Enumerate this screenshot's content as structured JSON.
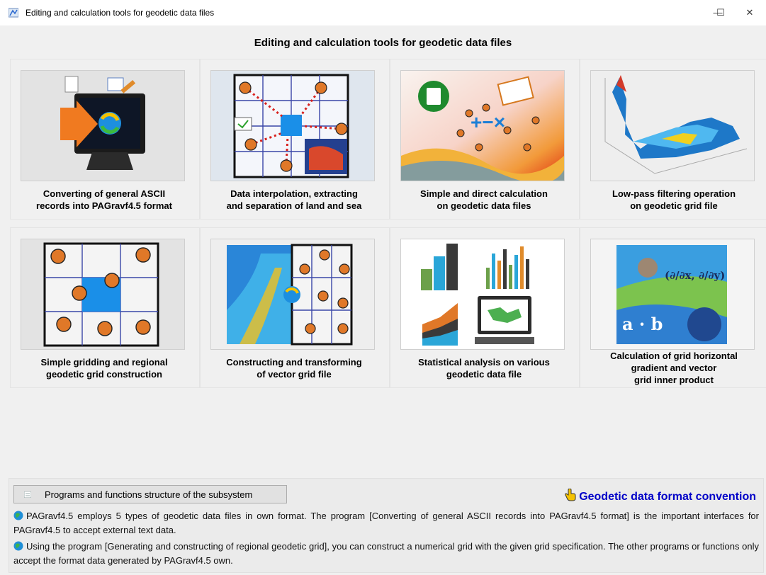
{
  "window": {
    "title": "Editing and calculation tools for geodetic data files",
    "minimize_label": "—",
    "maximize_label": "☐",
    "close_label": "✕",
    "app_icon": "app-icon"
  },
  "heading": "Editing and calculation tools for geodetic data files",
  "tools": [
    {
      "label": "Converting of general ASCII\nrecords into PAGravf4.5 format",
      "icon": "ascii-convert-image"
    },
    {
      "label": "Data interpolation, extracting\nand separation of land and sea",
      "icon": "interpolation-image"
    },
    {
      "label": "Simple and direct calculation\non geodetic data files",
      "icon": "calculation-image"
    },
    {
      "label": "Low-pass filtering operation\non geodetic grid file",
      "icon": "lowpass-filter-image"
    },
    {
      "label": "Simple gridding and regional\ngeodetic grid construction",
      "icon": "gridding-image"
    },
    {
      "label": "Constructing and transforming\nof vector grid file",
      "icon": "vector-grid-image"
    },
    {
      "label": "Statistical analysis on various\ngeodetic data file",
      "icon": "statistics-image"
    },
    {
      "label": "Calculation of grid horizontal\ngradient and vector\ngrid inner product",
      "icon": "gradient-product-image"
    }
  ],
  "bottom": {
    "programs_button": "Programs and functions structure of the subsystem",
    "format_link": "Geodetic data format convention",
    "para1": "PAGravf4.5 employs 5 types of geodetic data files in own format. The program [Converting of general ASCII records into PAGravf4.5 format] is the important interfaces for PAGravf4.5 to accept external text data.",
    "para2": "Using the program [Generating and constructing of regional geodetic grid], you can construct a numerical grid with the given grid specification. The other programs or functions only accept the format data generated by PAGravf4.5 own."
  },
  "image_text": {
    "gradient_formula": "(∂/∂x, ∂/∂y)",
    "dot_product": "a · b"
  },
  "colors": {
    "link": "#0000c8",
    "grid_line": "#2a3a9a",
    "marker": "#e07828",
    "cell_blue": "#1a8fe8"
  }
}
